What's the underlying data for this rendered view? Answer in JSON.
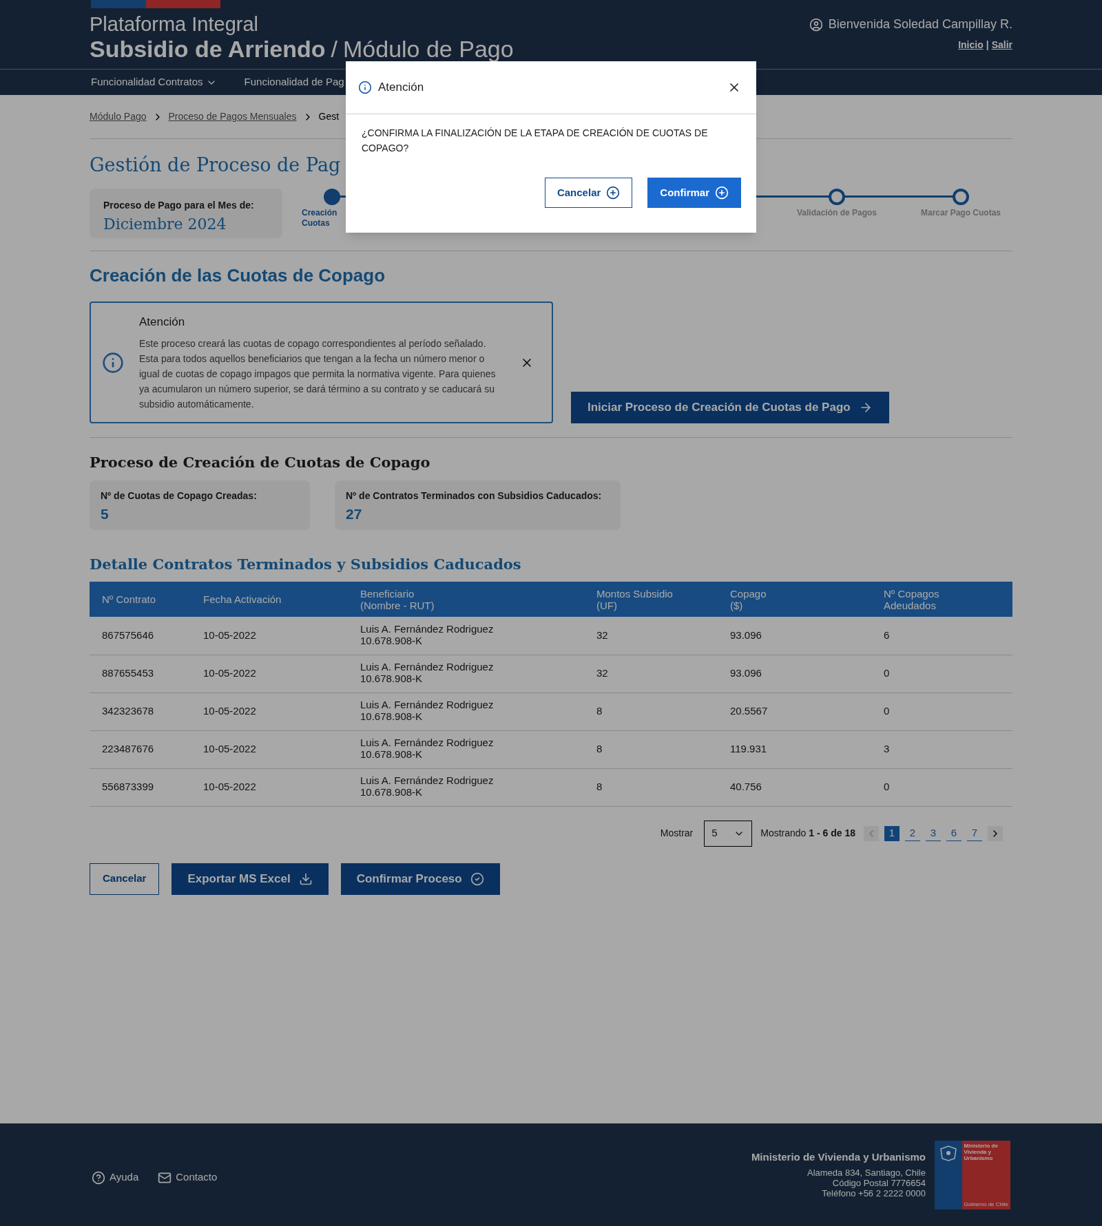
{
  "header": {
    "title_top": "Plataforma Integral",
    "title_bold": "Subsidio de Arriendo",
    "title_separator": "/",
    "title_rest": "Módulo de Pago",
    "user": "Bienvenida Soledad Campillay R.",
    "links": [
      "Inicio",
      "Salir"
    ],
    "link_separator": "|"
  },
  "nav": [
    {
      "label": "Funcionalidad Contratos",
      "dropdown": true
    },
    {
      "label": "Funcionalidad de Pag",
      "dropdown": false
    }
  ],
  "breadcrumb": [
    {
      "label": "Módulo Pago",
      "link": true
    },
    {
      "label": "Proceso de Pagos Mensuales",
      "link": true
    },
    {
      "label": "Gest",
      "link": false
    }
  ],
  "page_title": "Gestión de Proceso de Pag",
  "month_card": {
    "label": "Proceso de Pago para el Mes de:",
    "value": "Diciembre 2024"
  },
  "stepper": [
    {
      "lines": [
        "Creación",
        "Cuotas"
      ],
      "current": true
    },
    {
      "lines": [
        "Validación de Pagos"
      ],
      "current": false
    },
    {
      "lines": [
        "Marcar Pago Cuotas"
      ],
      "current": false
    }
  ],
  "section_title": "Creación de las Cuotas de Copago",
  "alert": {
    "title": "Atención",
    "text": "Este proceso creará las cuotas de copago correspondientes al período señalado. Esta para todos aquellos beneficiarios que tengan a la fecha un número menor o igual de cuotas de copago impagos que permita la normativa vigente. Para quienes ya acumularon un número superior, se dará término a su contrato y se caducará su subsidio automáticamente."
  },
  "start_button": "Iniciar Proceso de Creación de Cuotas de Pago",
  "process_heading": "Proceso de Creación de Cuotas de Copago",
  "stats": [
    {
      "label": "Nº de Cuotas de Copago Creadas:",
      "value": "5"
    },
    {
      "label": "Nº de Contratos Terminados con Subsidios Caducados:",
      "value": "27"
    }
  ],
  "table_title": "Detalle Contratos Terminados y Subsidios Caducados",
  "table": {
    "columns": [
      "Nº Contrato",
      "Fecha Activación",
      "Beneficiario\n(Nombre - RUT)",
      "Montos Subsidio\n(UF)",
      "Copago\n($)",
      "Nº Copagos\nAdeudados"
    ],
    "rows": [
      [
        "867575646",
        "10-05-2022",
        "Luis A. Fernández Rodriguez\n10.678.908-K",
        "32",
        "93.096",
        "6"
      ],
      [
        "887655453",
        "10-05-2022",
        "Luis A. Fernández Rodriguez\n10.678.908-K",
        "32",
        "93.096",
        "0"
      ],
      [
        "342323678",
        "10-05-2022",
        "Luis A. Fernández Rodriguez\n10.678.908-K",
        "8",
        "20.5567",
        "0"
      ],
      [
        "223487676",
        "10-05-2022",
        "Luis A. Fernández Rodriguez\n10.678.908-K",
        "8",
        "119.931",
        "3"
      ],
      [
        "556873399",
        "10-05-2022",
        "Luis A. Fernández Rodriguez\n10.678.908-K",
        "8",
        "40.756",
        "0"
      ]
    ]
  },
  "pagination": {
    "show_label": "Mostrar",
    "page_size": "5",
    "summary": "Mostrando **1 - 6 de 18**",
    "prev_disabled": true,
    "next_disabled": false,
    "pages": [
      {
        "label": "1",
        "selected": true
      },
      {
        "label": "2",
        "selected": false
      },
      {
        "label": "3",
        "selected": false
      },
      {
        "label": "6",
        "selected": false
      },
      {
        "label": "7",
        "selected": false
      }
    ]
  },
  "actions": [
    {
      "label": "Cancelar",
      "kind": "outline"
    },
    {
      "label": "Exportar MS Excel",
      "kind": "solid"
    },
    {
      "label": "Confirmar Proceso",
      "kind": "solid"
    }
  ],
  "footer": {
    "links": [
      "Ayuda",
      "Contacto"
    ],
    "ministry": "Ministerio de Vivienda y Urbanismo",
    "address": [
      "Alameda 834, Santiago, Chile",
      "Código Postal 7776654",
      "Teléfono +56 2 2222 0000"
    ],
    "logo_text": "Ministerio de Vivienda y Urbanismo",
    "logo_caption": "Gobierno de Chile"
  },
  "modal": {
    "title": "Atención",
    "message": "¿CONFIRMA LA FINALIZACIÓN DE LA ETAPA DE CREACIÓN DE CUOTAS DE COPAGO?",
    "buttons": [
      {
        "label": "Cancelar",
        "kind": "outline"
      },
      {
        "label": "Confirmar",
        "kind": "solid"
      }
    ]
  }
}
